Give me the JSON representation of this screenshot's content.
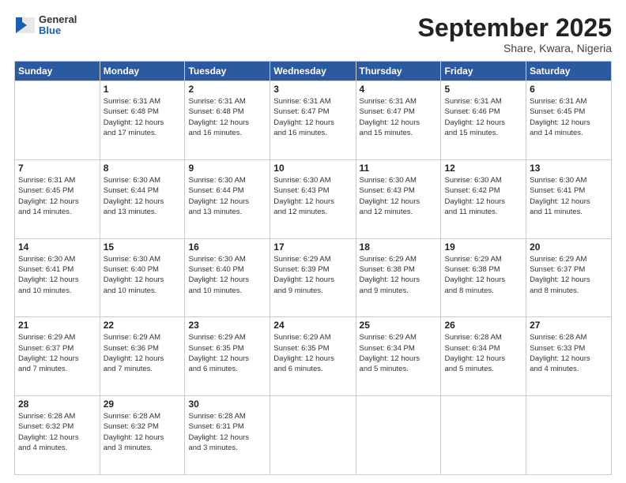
{
  "header": {
    "logo_general": "General",
    "logo_blue": "Blue",
    "month_title": "September 2025",
    "location": "Share, Kwara, Nigeria"
  },
  "days_of_week": [
    "Sunday",
    "Monday",
    "Tuesday",
    "Wednesday",
    "Thursday",
    "Friday",
    "Saturday"
  ],
  "weeks": [
    [
      {
        "day": "",
        "info": ""
      },
      {
        "day": "1",
        "info": "Sunrise: 6:31 AM\nSunset: 6:48 PM\nDaylight: 12 hours\nand 17 minutes."
      },
      {
        "day": "2",
        "info": "Sunrise: 6:31 AM\nSunset: 6:48 PM\nDaylight: 12 hours\nand 16 minutes."
      },
      {
        "day": "3",
        "info": "Sunrise: 6:31 AM\nSunset: 6:47 PM\nDaylight: 12 hours\nand 16 minutes."
      },
      {
        "day": "4",
        "info": "Sunrise: 6:31 AM\nSunset: 6:47 PM\nDaylight: 12 hours\nand 15 minutes."
      },
      {
        "day": "5",
        "info": "Sunrise: 6:31 AM\nSunset: 6:46 PM\nDaylight: 12 hours\nand 15 minutes."
      },
      {
        "day": "6",
        "info": "Sunrise: 6:31 AM\nSunset: 6:45 PM\nDaylight: 12 hours\nand 14 minutes."
      }
    ],
    [
      {
        "day": "7",
        "info": "Sunrise: 6:31 AM\nSunset: 6:45 PM\nDaylight: 12 hours\nand 14 minutes."
      },
      {
        "day": "8",
        "info": "Sunrise: 6:30 AM\nSunset: 6:44 PM\nDaylight: 12 hours\nand 13 minutes."
      },
      {
        "day": "9",
        "info": "Sunrise: 6:30 AM\nSunset: 6:44 PM\nDaylight: 12 hours\nand 13 minutes."
      },
      {
        "day": "10",
        "info": "Sunrise: 6:30 AM\nSunset: 6:43 PM\nDaylight: 12 hours\nand 12 minutes."
      },
      {
        "day": "11",
        "info": "Sunrise: 6:30 AM\nSunset: 6:43 PM\nDaylight: 12 hours\nand 12 minutes."
      },
      {
        "day": "12",
        "info": "Sunrise: 6:30 AM\nSunset: 6:42 PM\nDaylight: 12 hours\nand 11 minutes."
      },
      {
        "day": "13",
        "info": "Sunrise: 6:30 AM\nSunset: 6:41 PM\nDaylight: 12 hours\nand 11 minutes."
      }
    ],
    [
      {
        "day": "14",
        "info": "Sunrise: 6:30 AM\nSunset: 6:41 PM\nDaylight: 12 hours\nand 10 minutes."
      },
      {
        "day": "15",
        "info": "Sunrise: 6:30 AM\nSunset: 6:40 PM\nDaylight: 12 hours\nand 10 minutes."
      },
      {
        "day": "16",
        "info": "Sunrise: 6:30 AM\nSunset: 6:40 PM\nDaylight: 12 hours\nand 10 minutes."
      },
      {
        "day": "17",
        "info": "Sunrise: 6:29 AM\nSunset: 6:39 PM\nDaylight: 12 hours\nand 9 minutes."
      },
      {
        "day": "18",
        "info": "Sunrise: 6:29 AM\nSunset: 6:38 PM\nDaylight: 12 hours\nand 9 minutes."
      },
      {
        "day": "19",
        "info": "Sunrise: 6:29 AM\nSunset: 6:38 PM\nDaylight: 12 hours\nand 8 minutes."
      },
      {
        "day": "20",
        "info": "Sunrise: 6:29 AM\nSunset: 6:37 PM\nDaylight: 12 hours\nand 8 minutes."
      }
    ],
    [
      {
        "day": "21",
        "info": "Sunrise: 6:29 AM\nSunset: 6:37 PM\nDaylight: 12 hours\nand 7 minutes."
      },
      {
        "day": "22",
        "info": "Sunrise: 6:29 AM\nSunset: 6:36 PM\nDaylight: 12 hours\nand 7 minutes."
      },
      {
        "day": "23",
        "info": "Sunrise: 6:29 AM\nSunset: 6:35 PM\nDaylight: 12 hours\nand 6 minutes."
      },
      {
        "day": "24",
        "info": "Sunrise: 6:29 AM\nSunset: 6:35 PM\nDaylight: 12 hours\nand 6 minutes."
      },
      {
        "day": "25",
        "info": "Sunrise: 6:29 AM\nSunset: 6:34 PM\nDaylight: 12 hours\nand 5 minutes."
      },
      {
        "day": "26",
        "info": "Sunrise: 6:28 AM\nSunset: 6:34 PM\nDaylight: 12 hours\nand 5 minutes."
      },
      {
        "day": "27",
        "info": "Sunrise: 6:28 AM\nSunset: 6:33 PM\nDaylight: 12 hours\nand 4 minutes."
      }
    ],
    [
      {
        "day": "28",
        "info": "Sunrise: 6:28 AM\nSunset: 6:32 PM\nDaylight: 12 hours\nand 4 minutes."
      },
      {
        "day": "29",
        "info": "Sunrise: 6:28 AM\nSunset: 6:32 PM\nDaylight: 12 hours\nand 3 minutes."
      },
      {
        "day": "30",
        "info": "Sunrise: 6:28 AM\nSunset: 6:31 PM\nDaylight: 12 hours\nand 3 minutes."
      },
      {
        "day": "",
        "info": ""
      },
      {
        "day": "",
        "info": ""
      },
      {
        "day": "",
        "info": ""
      },
      {
        "day": "",
        "info": ""
      }
    ]
  ]
}
